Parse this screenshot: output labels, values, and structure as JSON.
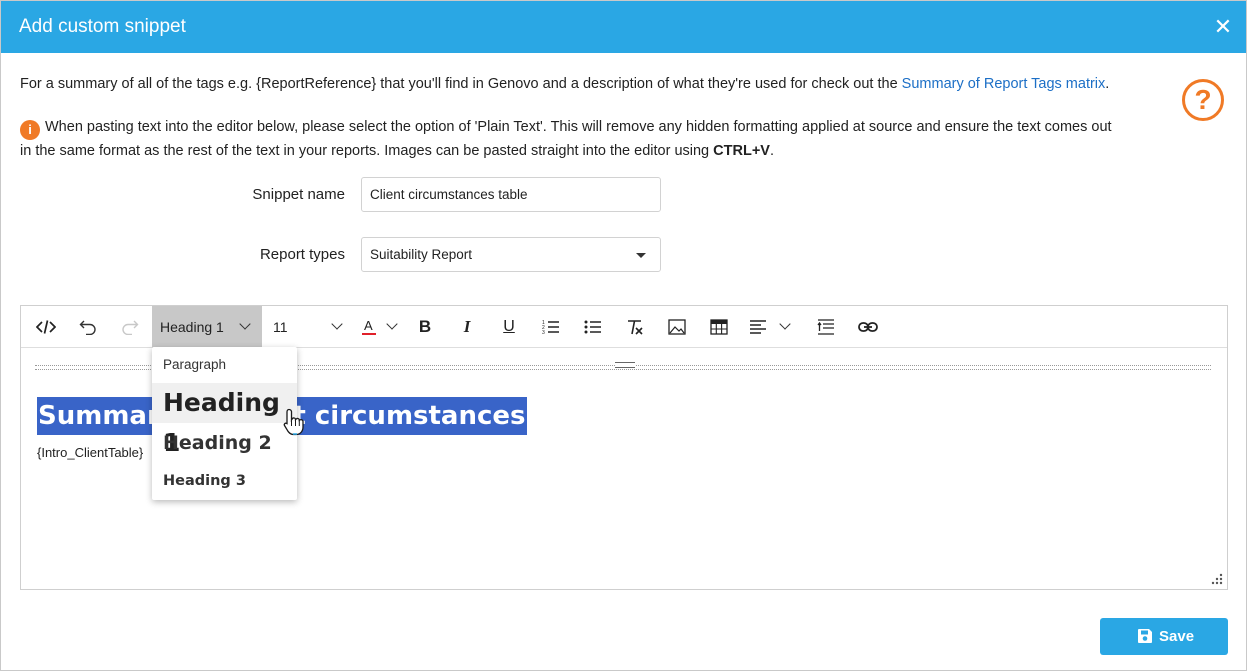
{
  "dialog": {
    "title": "Add custom snippet",
    "close_icon": "close-icon",
    "help_icon": "question-circle-icon",
    "info": {
      "text": "For a summary of all of the tags e.g. {ReportReference} that you'll find in Genovo and a description of what they're used for check out the ",
      "link": "Summary of Report Tags matrix",
      "after": "."
    },
    "warning": {
      "icon": "info-circle-icon",
      "line1": "When pasting text into the editor below, please select the option of 'Plain Text'. This will remove any hidden formatting applied at source and ensure the text comes out",
      "line2": "in the same format as the rest of the text in your reports. Images can be pasted straight into the editor using ",
      "shortcut": "CTRL+V",
      "after": "."
    }
  },
  "form": {
    "snippet_name_label": "Snippet name",
    "snippet_name_value": "Client circumstances table",
    "report_types_label": "Report types",
    "report_types_value": "Suitability Report"
  },
  "toolbar": {
    "block_format": "Heading 1",
    "font_size": "11",
    "font_color_glyph": "A",
    "font_color": "#e0202a",
    "bold_glyph": "B",
    "italic_glyph": "I",
    "underline_glyph": "U",
    "tools": [
      "source-code-icon",
      "undo-icon",
      "redo-icon",
      "font-color-icon",
      "bold-icon",
      "italic-icon",
      "underline-icon",
      "numbered-list-icon",
      "bullet-list-icon",
      "clear-formatting-icon",
      "image-icon",
      "table-icon",
      "align-left-icon",
      "line-height-icon",
      "link-icon"
    ]
  },
  "block_dropdown": {
    "items": [
      "Paragraph",
      "Heading 1",
      "Heading 2",
      "Heading 3"
    ],
    "selected": "Heading 1"
  },
  "content": {
    "heading": "Summary of client circumstances",
    "tag": "{Intro_ClientTable}"
  },
  "actions": {
    "save_label": "Save",
    "save_icon": "floppy-disk-icon"
  },
  "colors": {
    "header_bg": "#2aa7e4",
    "accent_orange": "#f07a26",
    "link_blue": "#1c6fc6",
    "selection_blue": "#3964c8",
    "save_button": "#2aa7e4"
  }
}
